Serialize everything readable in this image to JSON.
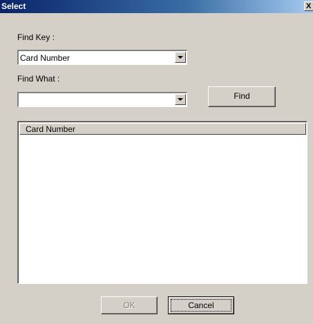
{
  "window": {
    "title": "Select",
    "close_label": "X"
  },
  "find_key": {
    "label": "Find Key :",
    "selected_value": "Card Number"
  },
  "find_what": {
    "label": "Find What :",
    "value": ""
  },
  "find_button": {
    "label": "Find"
  },
  "results_list": {
    "columns": [
      "Card Number"
    ],
    "rows": []
  },
  "buttons": {
    "ok_label": "OK",
    "cancel_label": "Cancel"
  },
  "colors": {
    "titlebar_start": "#0a246a",
    "titlebar_end": "#a6caf0",
    "dialog_bg": "#d4d0c8"
  }
}
